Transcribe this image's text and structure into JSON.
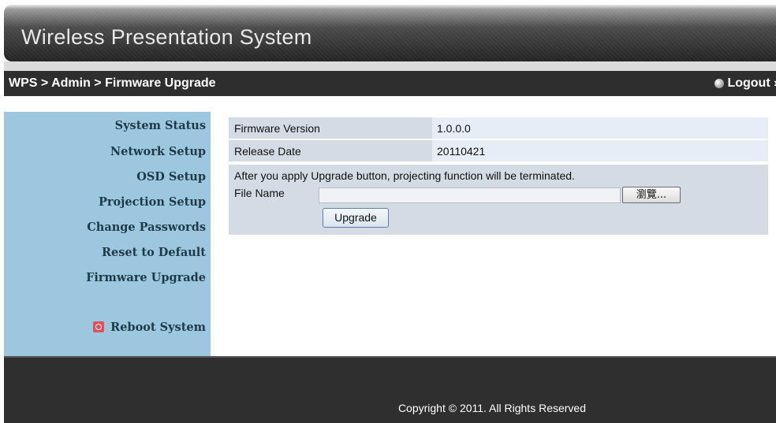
{
  "app": {
    "title": "Wireless Presentation System"
  },
  "nav": {
    "breadcrumb": "WPS > Admin > Firmware Upgrade",
    "logout_label": "Logout »"
  },
  "sidebar": {
    "items": [
      {
        "label": "System Status"
      },
      {
        "label": "Network Setup"
      },
      {
        "label": "OSD Setup"
      },
      {
        "label": "Projection Setup"
      },
      {
        "label": "Change Passwords"
      },
      {
        "label": "Reset to Default"
      },
      {
        "label": "Firmware Upgrade"
      }
    ],
    "reboot_label": "Reboot System"
  },
  "firmware": {
    "rows": [
      {
        "label": "Firmware Version",
        "value": "1.0.0.0"
      },
      {
        "label": "Release Date",
        "value": "20110421"
      }
    ],
    "notice": "After you apply Upgrade button, projecting function will be terminated.",
    "file_label": "File Name",
    "file_value": "",
    "browse_label": "瀏覽...",
    "upgrade_label": "Upgrade"
  },
  "footer": {
    "copyright": "Copyright © 2011. All Rights Reserved"
  },
  "colors": {
    "sidebar_bg": "#9dc7df",
    "navbar_bg": "#2e2e2e",
    "row_label_bg": "#d4dbe4",
    "row_value_bg": "#e6edf6",
    "footer_bg": "#2f2f2f"
  },
  "icons": {
    "logout": "logout-dot-icon",
    "reboot": "power-icon"
  }
}
